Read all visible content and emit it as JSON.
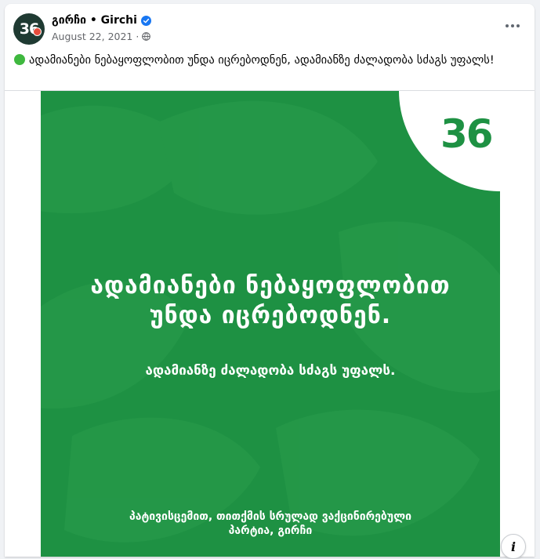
{
  "post": {
    "page_name": "გირჩი • Girchi",
    "avatar_text": "36",
    "date": "August 22, 2021",
    "separator": "·",
    "text": "ადამიანები ნებაყოფლობით უნდა იცრებოდნენ, ადამიანზე ძალადობა სძაგს უფალს!",
    "status_dot_color": "#3fb83f"
  },
  "image": {
    "logo": "36",
    "headline_line1": "ადამიანები ნებაყოფლობით",
    "headline_line2": "უნდა იცრებოდნენ.",
    "subhead": "ადამიანზე ძალადობა სძაგს უფალს.",
    "footer_line1": "პატივისცემით, თითქმის სრულად ვაქცინირებული",
    "footer_line2": "პარტია, გირჩი",
    "background_color": "#1e9143"
  },
  "icons": {
    "verified": "verified-badge-icon",
    "audience": "globe-icon",
    "more": "more-options-icon",
    "info": "info-icon"
  },
  "info_label": "i"
}
